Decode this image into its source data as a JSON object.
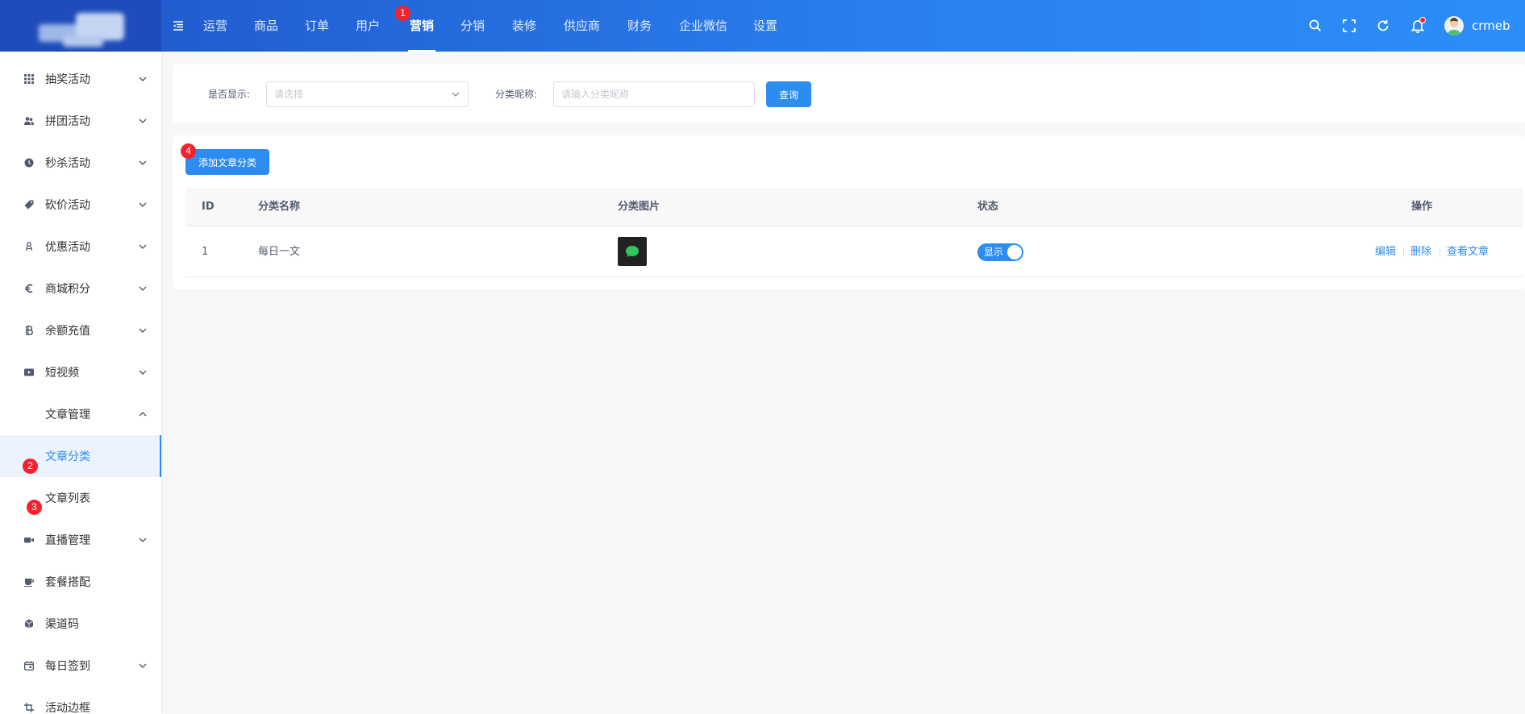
{
  "header": {
    "nav": [
      {
        "label": "运营"
      },
      {
        "label": "商品"
      },
      {
        "label": "订单"
      },
      {
        "label": "用户"
      },
      {
        "label": "营销"
      },
      {
        "label": "分销"
      },
      {
        "label": "装修"
      },
      {
        "label": "供应商"
      },
      {
        "label": "财务"
      },
      {
        "label": "企业微信"
      },
      {
        "label": "设置"
      }
    ],
    "active_nav": "营销",
    "username": "crmeb",
    "accent_color": "#2d8cf0",
    "header_gradient": [
      "#1f55c8",
      "#2c8ef8"
    ]
  },
  "markers": [
    "1",
    "2",
    "3",
    "4"
  ],
  "sidebar": {
    "items": [
      {
        "label": "抽奖活动",
        "icon": "grid-icon"
      },
      {
        "label": "拼团活动",
        "icon": "group-icon"
      },
      {
        "label": "秒杀活动",
        "icon": "clock-icon"
      },
      {
        "label": "砍价活动",
        "icon": "tag-icon"
      },
      {
        "label": "优惠活动",
        "icon": "discount-icon"
      },
      {
        "label": "商城积分",
        "icon": "euro-icon"
      },
      {
        "label": "余额充值",
        "icon": "coin-icon"
      },
      {
        "label": "短视频",
        "icon": "video-icon"
      },
      {
        "label": "文章管理",
        "icon": "article-icon"
      },
      {
        "label": "文章分类",
        "icon": ""
      },
      {
        "label": "文章列表",
        "icon": ""
      },
      {
        "label": "直播管理",
        "icon": "camera-icon"
      },
      {
        "label": "套餐搭配",
        "icon": "cup-icon"
      },
      {
        "label": "渠道码",
        "icon": "cube-icon"
      },
      {
        "label": "每日签到",
        "icon": "calendar-icon"
      },
      {
        "label": "活动边框",
        "icon": "frame-icon"
      }
    ],
    "active_item": "文章分类"
  },
  "filter": {
    "show_label": "是否显示:",
    "show_placeholder": "请选择",
    "name_label": "分类昵称:",
    "name_placeholder": "请输入分类昵称",
    "query_button": "查询"
  },
  "actions": {
    "add_button": "添加文章分类"
  },
  "table": {
    "columns": [
      "ID",
      "分类名称",
      "分类图片",
      "状态",
      "操作"
    ],
    "rows": [
      {
        "id": "1",
        "name": "每日一文",
        "status_label": "显示",
        "status_on": true,
        "ops": [
          "编辑",
          "删除",
          "查看文章"
        ]
      }
    ]
  }
}
